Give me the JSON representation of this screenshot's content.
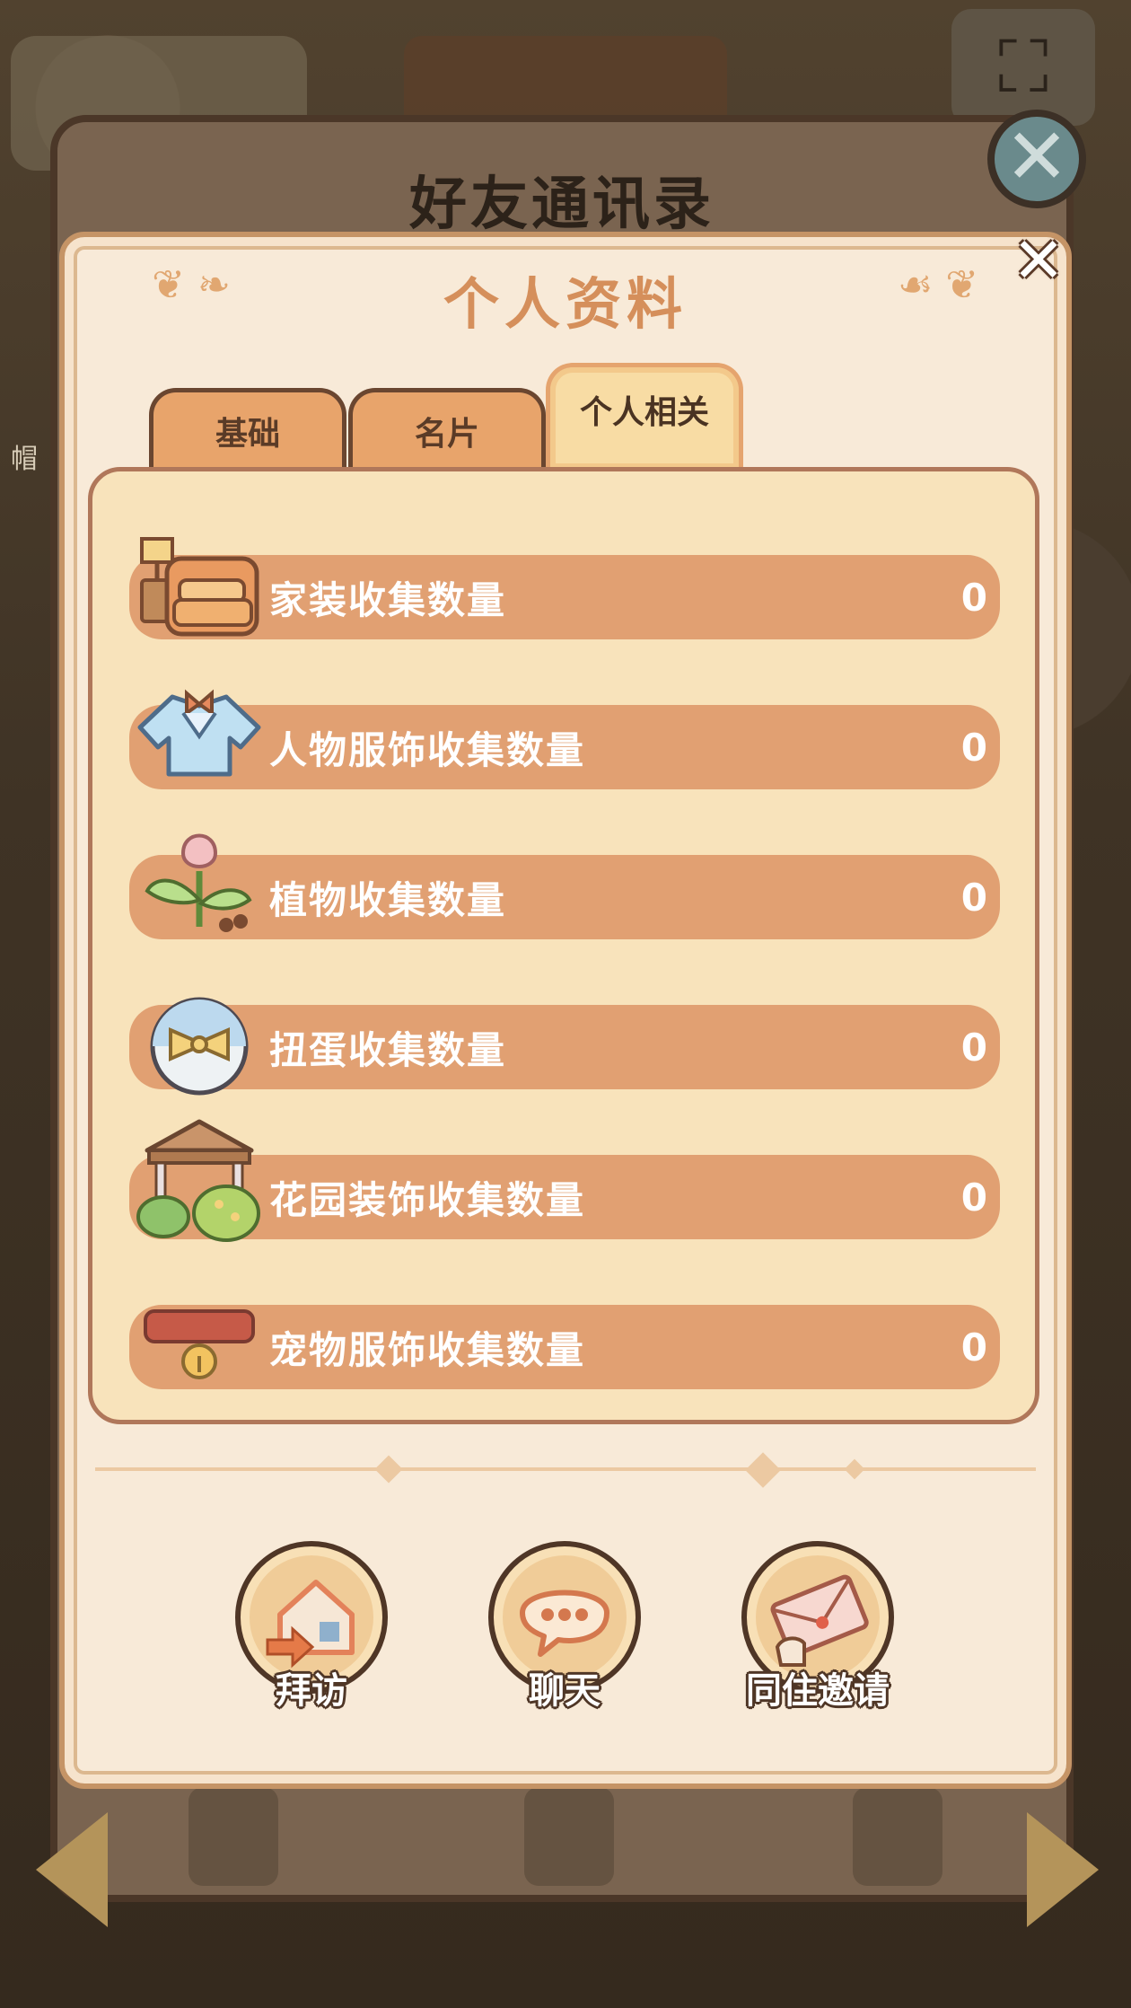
{
  "background": {
    "back_dialog_title": "好友通讯录",
    "side_label": "帽"
  },
  "profile": {
    "title": "个人资料",
    "close_glyph": "✕",
    "tabs": [
      {
        "label": "基础",
        "active": false
      },
      {
        "label": "名片",
        "active": false
      },
      {
        "label": "个人相关",
        "active": true
      }
    ],
    "stats": [
      {
        "label": "家装收集数量",
        "value": "0",
        "icon": "sofa-lamp-icon"
      },
      {
        "label": "人物服饰收集数量",
        "value": "0",
        "icon": "shirt-icon"
      },
      {
        "label": "植物收集数量",
        "value": "0",
        "icon": "flower-sprout-icon"
      },
      {
        "label": "扭蛋收集数量",
        "value": "0",
        "icon": "capsule-egg-icon"
      },
      {
        "label": "花园装饰收集数量",
        "value": "0",
        "icon": "gazebo-icon"
      },
      {
        "label": "宠物服饰收集数量",
        "value": "0",
        "icon": "pet-collar-icon"
      }
    ],
    "actions": [
      {
        "label": "拜访",
        "icon": "house-visit-icon"
      },
      {
        "label": "聊天",
        "icon": "chat-bubble-icon"
      },
      {
        "label": "同住邀请",
        "icon": "invitation-letter-icon"
      }
    ]
  },
  "colors": {
    "row_fill": "#e1a072",
    "panel_fill": "#f8e3bb",
    "title": "#d58f5b",
    "active_tab": "#f8dca4"
  }
}
